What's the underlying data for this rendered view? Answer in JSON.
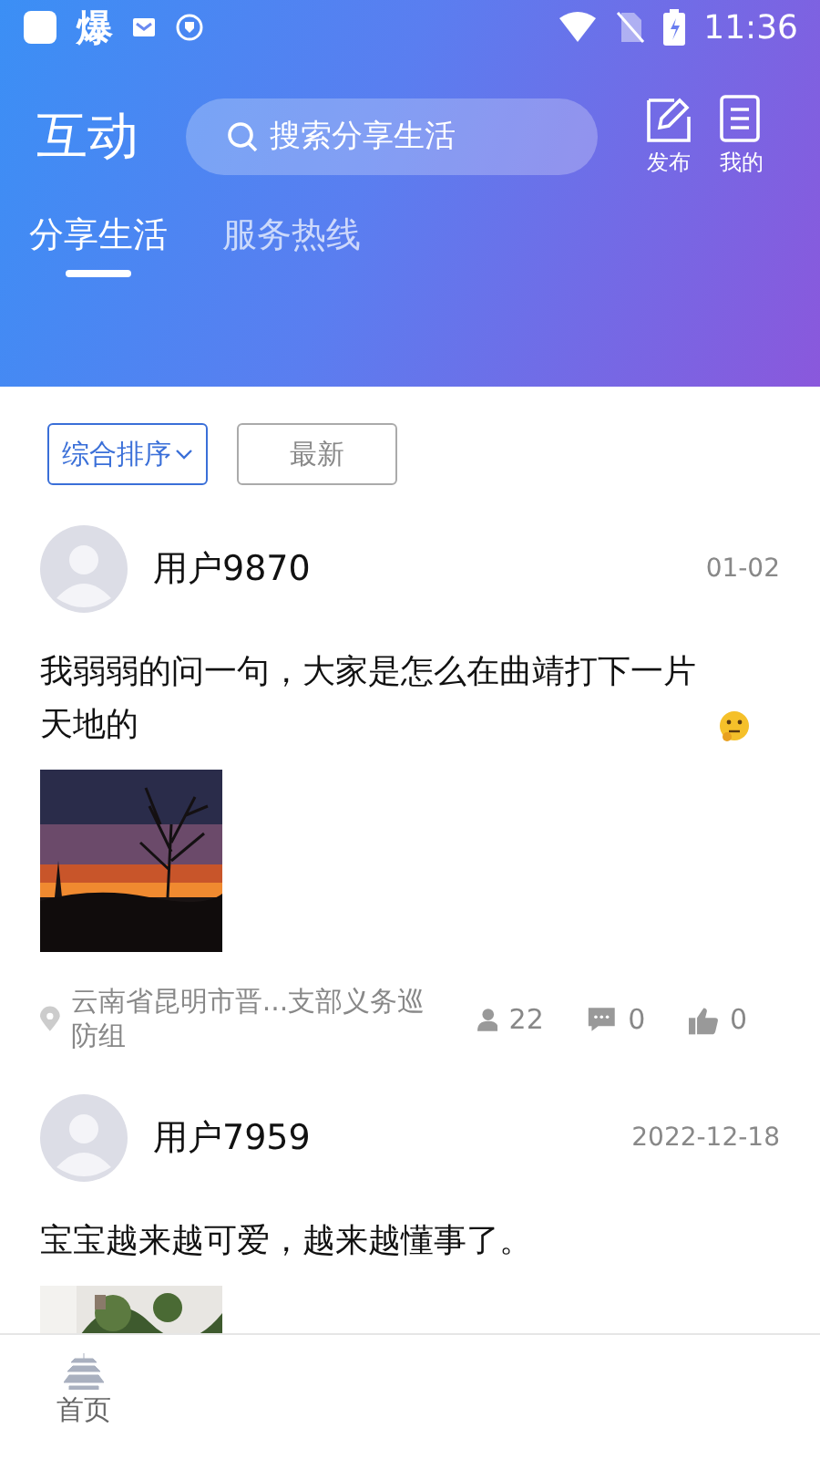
{
  "status_bar": {
    "app_label": "爆",
    "time": "11:36"
  },
  "header": {
    "title": "互动",
    "search": {
      "placeholder": "搜索分享生活"
    },
    "actions": [
      {
        "kind": "compose",
        "label": "发布"
      },
      {
        "kind": "document",
        "label": "我的"
      }
    ]
  },
  "tabs": [
    {
      "label": "分享生活",
      "selected": true
    },
    {
      "label": "服务热线",
      "selected": false
    }
  ],
  "sort_options": [
    {
      "label": "综合排序",
      "selected": true,
      "dropdown": true
    },
    {
      "label": "最新",
      "selected": false,
      "dropdown": false
    }
  ],
  "posts": [
    {
      "user": "用户9870",
      "date": "01-02",
      "text": "我弱弱的问一句，大家是怎么在曲靖打下一片天地的",
      "emoji": true,
      "location": "云南省昆明市晋...支部义务巡防组",
      "views": "22",
      "comments": "0",
      "likes": "0"
    },
    {
      "user": "用户7959",
      "date": "2022-12-18",
      "text": "宝宝越来越可爱，越来越懂事了。",
      "emoji": false
    }
  ],
  "bottom_nav": [
    {
      "label": "首页",
      "kind": "home"
    }
  ]
}
